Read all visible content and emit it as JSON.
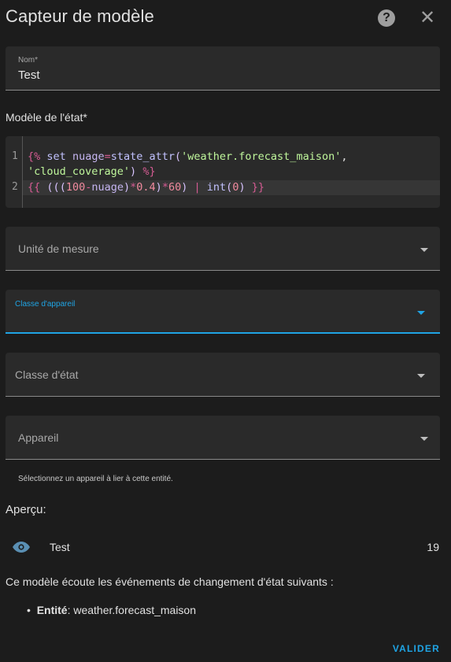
{
  "dialog": {
    "title": "Capteur de modèle",
    "help_icon": "help-circle-icon",
    "close_icon": "close-icon"
  },
  "fields": {
    "name": {
      "label": "Nom*",
      "value": "Test"
    },
    "template_label": "Modèle de l'état*",
    "unit": {
      "label": "Unité de mesure"
    },
    "device_class": {
      "label": "Classe d'appareil",
      "active": true
    },
    "state_class": {
      "label": "Classe d'état"
    },
    "device": {
      "label": "Appareil",
      "helper": "Sélectionnez un appareil à lier à cette entité."
    }
  },
  "code": {
    "line_numbers": [
      "1",
      "2"
    ],
    "line1a": "{% set nuage=state_attr('weather.forecast_maison',",
    "line1b": "'cloud_coverage') %}",
    "line2": "{{ (((100-nuage)*0.4)*60) | int(0) }}"
  },
  "preview": {
    "label": "Aperçu:",
    "entity_name": "Test",
    "entity_value": "19",
    "listen_text": "Ce modèle écoute les événements de changement d'état suivants :",
    "listen_bold": "Entité",
    "listen_entity": ": weather.forecast_maison"
  },
  "actions": {
    "validate": "VALIDER"
  },
  "colors": {
    "accent": "#1fa4e4",
    "background": "#1c1c1c",
    "field": "#2a2a2a"
  }
}
